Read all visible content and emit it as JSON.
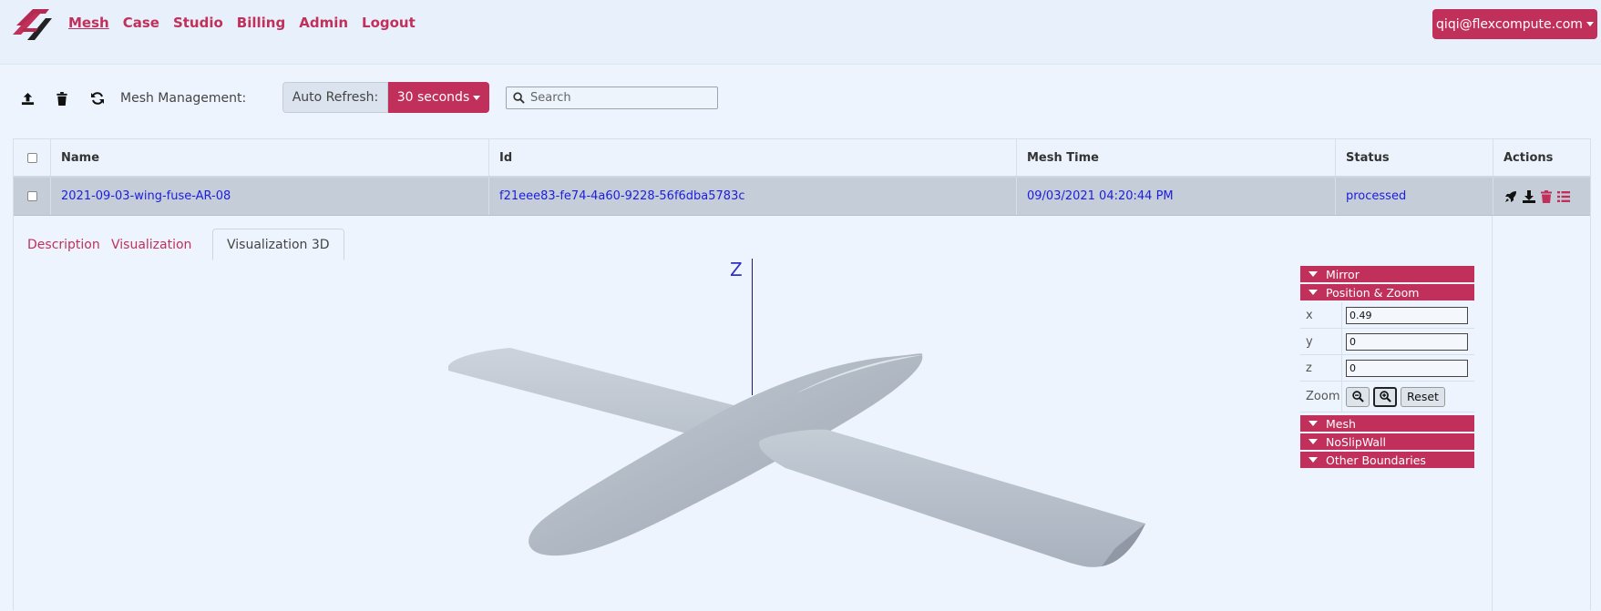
{
  "nav": {
    "links": [
      "Mesh",
      "Case",
      "Studio",
      "Billing",
      "Admin",
      "Logout"
    ],
    "active": "Mesh",
    "user": "qiqi@flexcompute.com",
    "accent": "#c0305a"
  },
  "toolbar": {
    "icons": [
      "upload-icon",
      "trash-icon",
      "refresh-icon"
    ],
    "label": "Mesh Management:",
    "auto_refresh_label": "Auto Refresh:",
    "refresh_value": "30 seconds",
    "search_placeholder": "Search"
  },
  "table": {
    "headers": [
      "Name",
      "Id",
      "Mesh Time",
      "Status",
      "Actions"
    ],
    "rows": [
      {
        "name": "2021-09-03-wing-fuse-AR-08",
        "id": "f21eee83-fe74-4a60-9228-56f6dba5783c",
        "mesh_time": "09/03/2021 04:20:44 PM",
        "status": "processed",
        "actions": [
          "rocket-icon",
          "download-icon",
          "trash-icon",
          "list-icon"
        ]
      }
    ]
  },
  "tabs": [
    "Description",
    "Visualization",
    "Visualization 3D"
  ],
  "active_tab": "Visualization 3D",
  "viewer": {
    "axis_label": "Z"
  },
  "gui": {
    "folders": {
      "mirror": "Mirror",
      "position_zoom": "Position & Zoom",
      "mesh": "Mesh",
      "noslipwall": "NoSlipWall",
      "other": "Other Boundaries"
    },
    "x_label": "x",
    "x_value": "0.49",
    "y_label": "y",
    "y_value": "0",
    "z_label": "z",
    "z_value": "0",
    "zoom_label": "Zoom",
    "reset_label": "Reset"
  }
}
